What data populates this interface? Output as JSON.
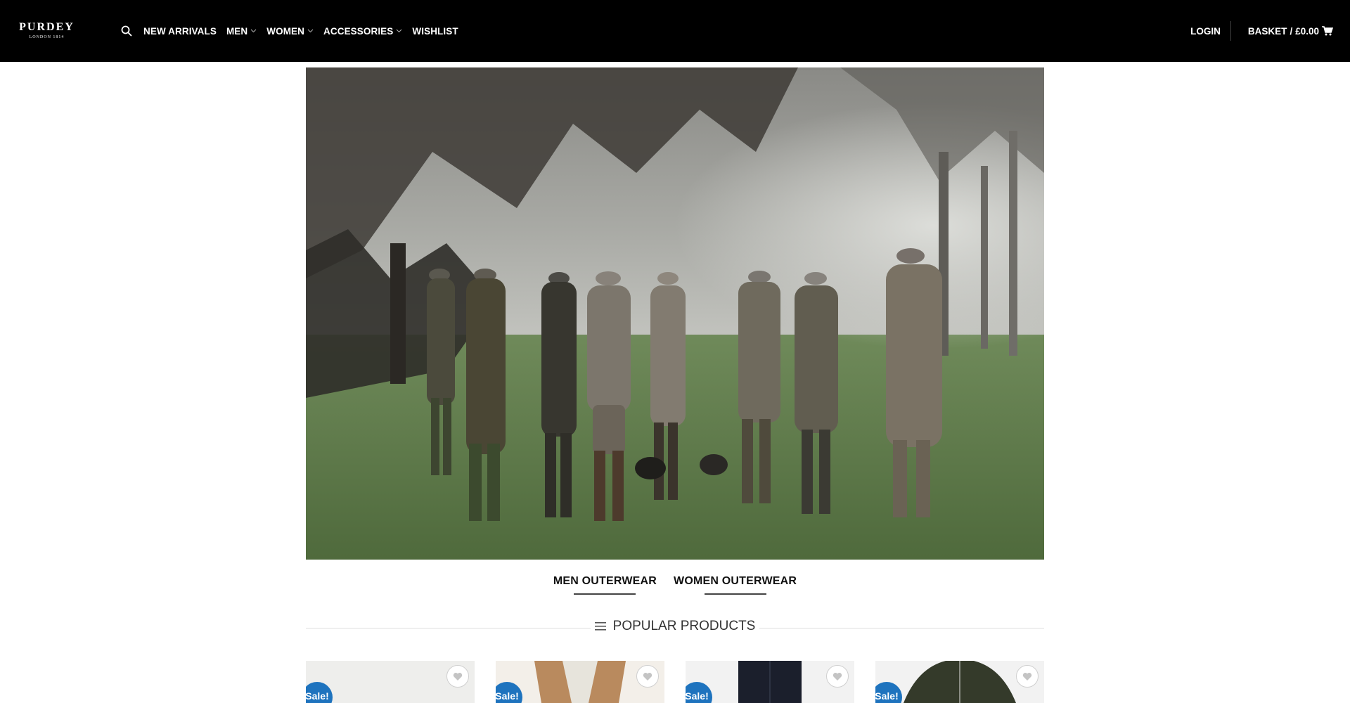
{
  "header": {
    "logo": {
      "name": "PURDEY",
      "sub": "LONDON 1814"
    },
    "search_icon": "search-icon",
    "nav": [
      {
        "label": "NEW ARRIVALS",
        "dropdown": false
      },
      {
        "label": "MEN",
        "dropdown": true
      },
      {
        "label": "WOMEN",
        "dropdown": true
      },
      {
        "label": "ACCESSORIES",
        "dropdown": true
      },
      {
        "label": "WISHLIST",
        "dropdown": false
      }
    ],
    "login": "LOGIN",
    "basket": {
      "label": "BASKET",
      "separator": "/",
      "amount": "£0.00",
      "icon": "cart-icon"
    }
  },
  "categories": [
    {
      "label": "MEN OUTERWEAR"
    },
    {
      "label": "WOMEN OUTERWEAR"
    }
  ],
  "section": {
    "title": "POPULAR PRODUCTS",
    "icon": "menu-icon"
  },
  "products": [
    {
      "badge": "Sale!",
      "wishlist_icon": "heart-icon"
    },
    {
      "badge": "Sale!",
      "wishlist_icon": "heart-icon"
    },
    {
      "badge": "Sale!",
      "wishlist_icon": "heart-icon"
    },
    {
      "badge": "Sale!",
      "wishlist_icon": "heart-icon"
    }
  ],
  "colors": {
    "header_bg": "#000000",
    "badge_bg": "#1e73be"
  }
}
